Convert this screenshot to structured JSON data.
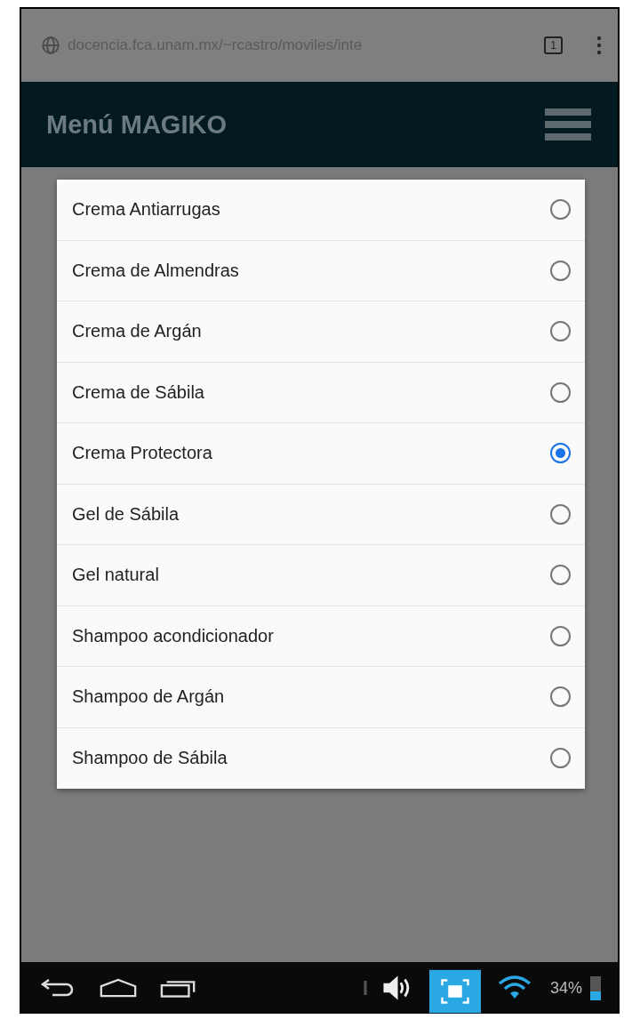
{
  "browser": {
    "url": "docencia.fca.unam.mx/~rcastro/moviles/inte",
    "tab_count": "1"
  },
  "header": {
    "title": "Menú MAGIKO"
  },
  "dialog": {
    "options": [
      {
        "label": "Crema Antiarrugas",
        "selected": false
      },
      {
        "label": "Crema de Almendras",
        "selected": false
      },
      {
        "label": "Crema de Argán",
        "selected": false
      },
      {
        "label": "Crema de Sábila",
        "selected": false
      },
      {
        "label": "Crema Protectora",
        "selected": true
      },
      {
        "label": "Gel de Sábila",
        "selected": false
      },
      {
        "label": "Gel natural",
        "selected": false
      },
      {
        "label": "Shampoo acondicionador",
        "selected": false
      },
      {
        "label": "Shampoo de Argán",
        "selected": false
      },
      {
        "label": "Shampoo de Sábila",
        "selected": false
      }
    ]
  },
  "status_bar": {
    "battery": "34%"
  }
}
